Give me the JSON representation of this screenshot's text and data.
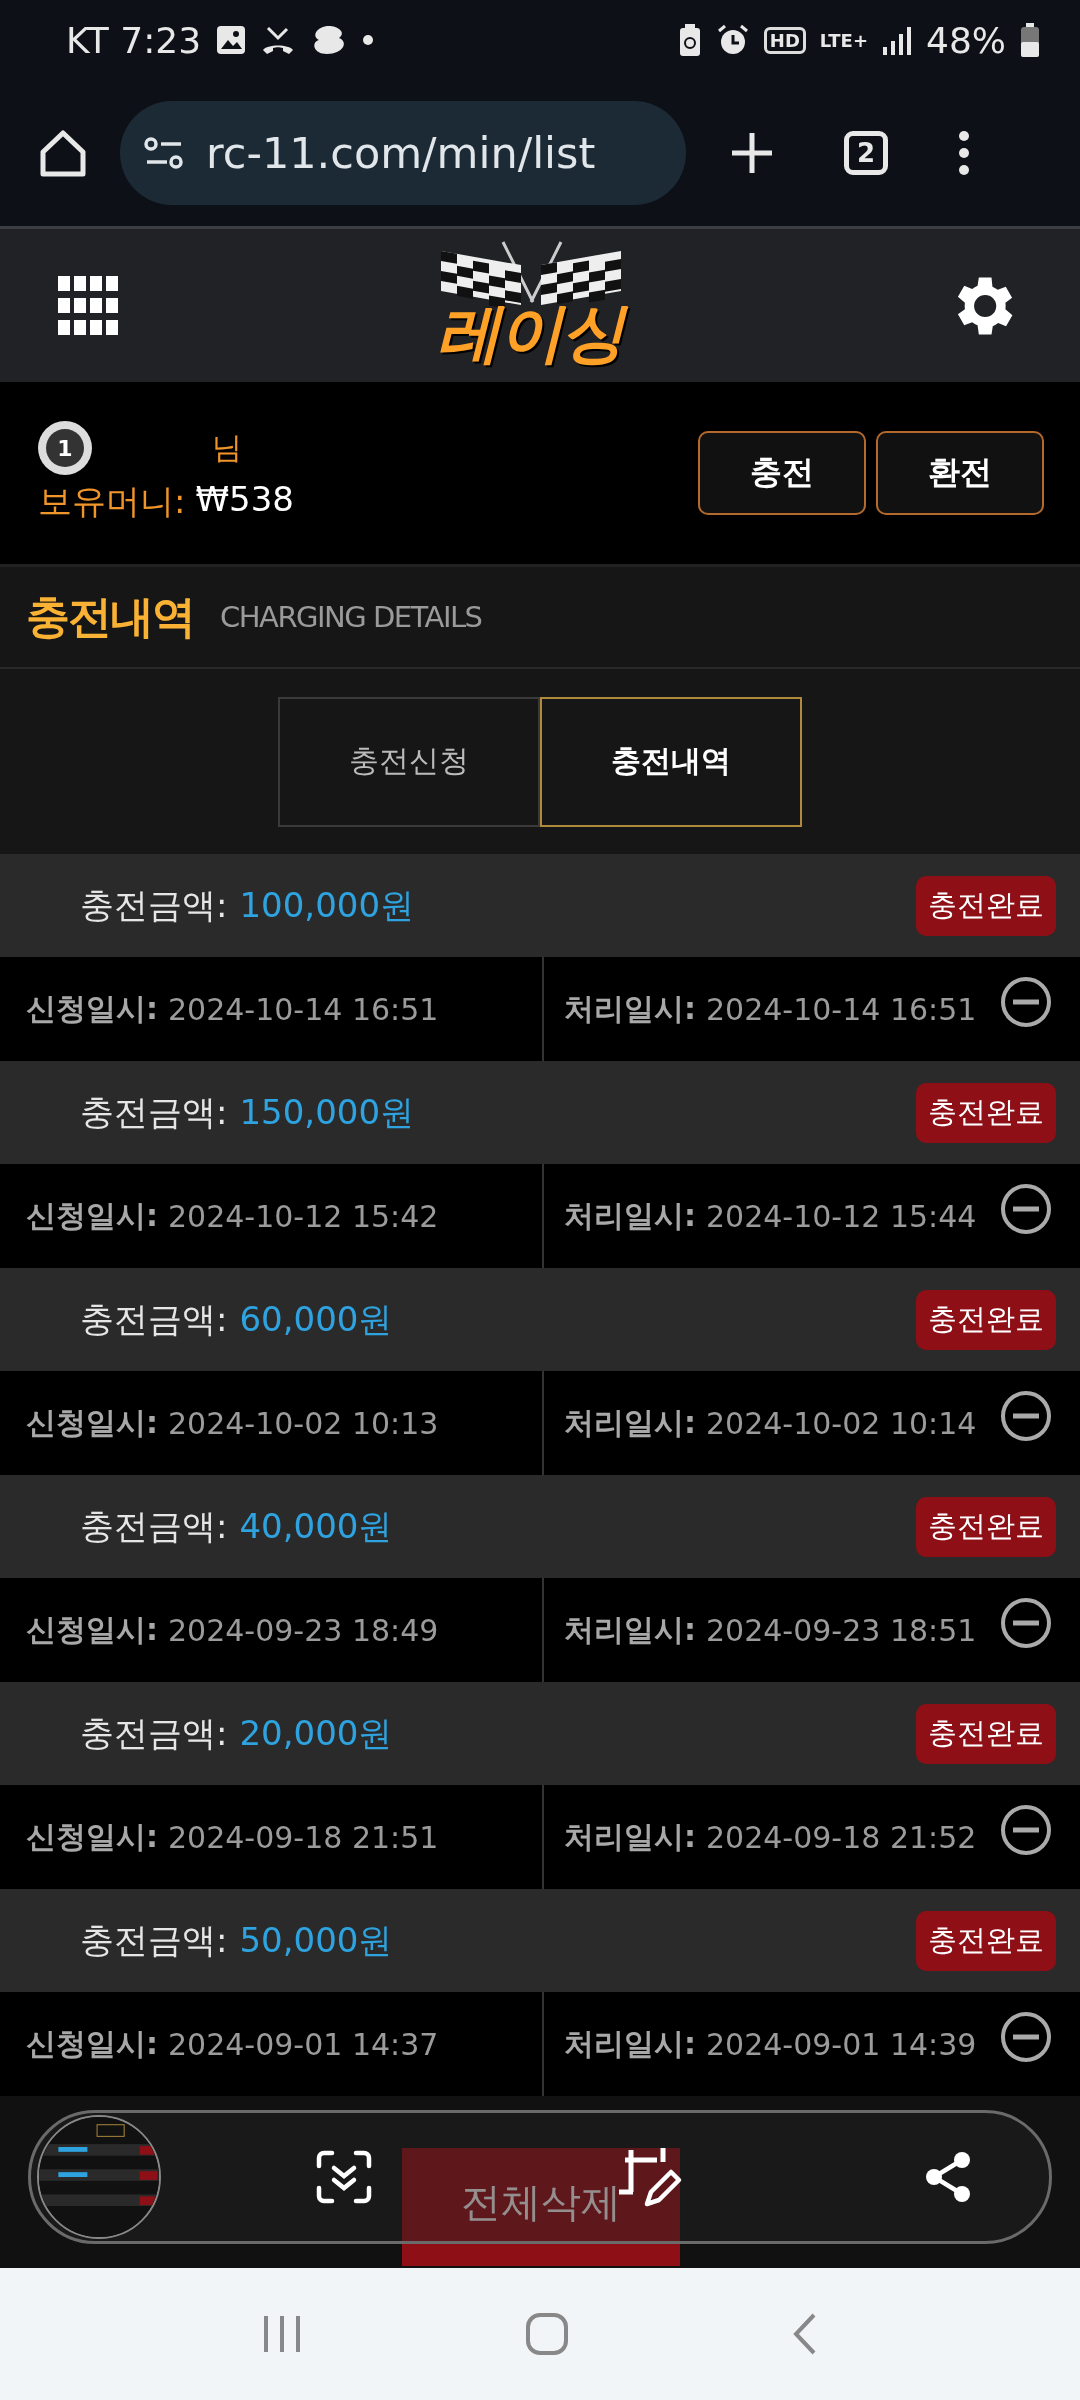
{
  "status_bar": {
    "carrier_time": "KT 7:23",
    "hd": "HD",
    "network": "LTE+",
    "battery": "48%"
  },
  "browser": {
    "url": "rc-11.com/min/list",
    "tab_count": "2"
  },
  "site_header": {
    "logo": "레이싱"
  },
  "user": {
    "level": "1",
    "name_suffix": "님",
    "balance_label": "보유머니:",
    "balance": "₩538",
    "buttons": [
      "충전",
      "환전"
    ]
  },
  "section": {
    "title": "충전내역",
    "subtitle": "CHARGING DETAILS"
  },
  "tabs": [
    {
      "label": "충전신청",
      "selected": false
    },
    {
      "label": "충전내역",
      "selected": true
    }
  ],
  "records": [
    {
      "amount_label": "충전금액:",
      "amount": "100,000원",
      "status": "충전완료",
      "request_label": "신청일시:",
      "request_time": "2024-10-14 16:51",
      "processed_label": "처리일시:",
      "processed_time": "2024-10-14 16:51"
    },
    {
      "amount_label": "충전금액:",
      "amount": "150,000원",
      "status": "충전완료",
      "request_label": "신청일시:",
      "request_time": "2024-10-12 15:42",
      "processed_label": "처리일시:",
      "processed_time": "2024-10-12 15:44"
    },
    {
      "amount_label": "충전금액:",
      "amount": "60,000원",
      "status": "충전완료",
      "request_label": "신청일시:",
      "request_time": "2024-10-02 10:13",
      "processed_label": "처리일시:",
      "processed_time": "2024-10-02 10:14"
    },
    {
      "amount_label": "충전금액:",
      "amount": "40,000원",
      "status": "충전완료",
      "request_label": "신청일시:",
      "request_time": "2024-09-23 18:49",
      "processed_label": "처리일시:",
      "processed_time": "2024-09-23 18:51"
    },
    {
      "amount_label": "충전금액:",
      "amount": "20,000원",
      "status": "충전완료",
      "request_label": "신청일시:",
      "request_time": "2024-09-18 21:51",
      "processed_label": "처리일시:",
      "processed_time": "2024-09-18 21:52"
    },
    {
      "amount_label": "충전금액:",
      "amount": "50,000원",
      "status": "충전완료",
      "request_label": "신청일시:",
      "request_time": "2024-09-01 14:37",
      "processed_label": "처리일시:",
      "processed_time": "2024-09-01 14:39"
    }
  ],
  "delete_all_button": "전체삭제"
}
